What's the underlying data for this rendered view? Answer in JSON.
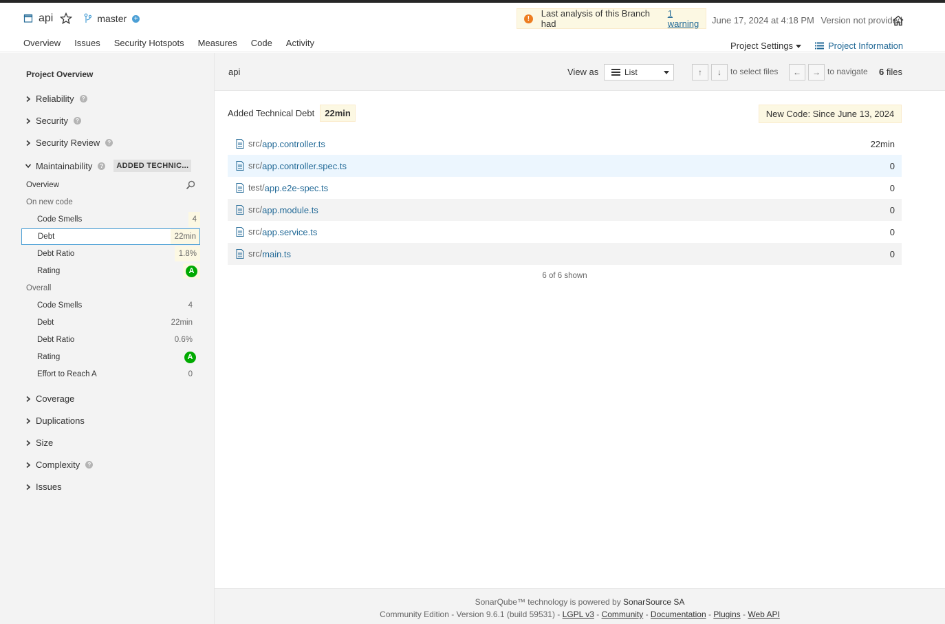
{
  "header": {
    "project_name": "api",
    "branch": "master",
    "warning_text": "Last analysis of this Branch had",
    "warning_link": "1 warning",
    "analysis_date": "June 17, 2024 at 4:18 PM",
    "version": "Version not provided",
    "tabs": [
      {
        "label": "Overview"
      },
      {
        "label": "Issues"
      },
      {
        "label": "Security Hotspots"
      },
      {
        "label": "Measures"
      },
      {
        "label": "Code"
      },
      {
        "label": "Activity"
      }
    ],
    "project_settings": "Project Settings",
    "project_information": "Project Information"
  },
  "sidebar": {
    "title": "Project Overview",
    "domains": {
      "reliability": "Reliability",
      "security": "Security",
      "security_review": "Security Review",
      "maintainability": "Maintainability",
      "maintainability_tag": "ADDED TECHNIC...",
      "coverage": "Coverage",
      "duplications": "Duplications",
      "size": "Size",
      "complexity": "Complexity",
      "issues": "Issues"
    },
    "overview_label": "Overview",
    "on_new_code_label": "On new code",
    "overall_label": "Overall",
    "new_code": {
      "code_smells": {
        "label": "Code Smells",
        "value": "4"
      },
      "debt": {
        "label": "Debt",
        "value": "22min"
      },
      "debt_ratio": {
        "label": "Debt Ratio",
        "value": "1.8%"
      },
      "rating": {
        "label": "Rating",
        "value": "A"
      }
    },
    "overall": {
      "code_smells": {
        "label": "Code Smells",
        "value": "4"
      },
      "debt": {
        "label": "Debt",
        "value": "22min"
      },
      "debt_ratio": {
        "label": "Debt Ratio",
        "value": "0.6%"
      },
      "rating": {
        "label": "Rating",
        "value": "A"
      },
      "effort": {
        "label": "Effort to Reach A",
        "value": "0"
      }
    }
  },
  "main": {
    "breadcrumb": "api",
    "view_as_label": "View as",
    "view_as_value": "List",
    "select_hint": "to select files",
    "navigate_hint": "to navigate",
    "files_count": "6",
    "files_label": "files",
    "metric_label": "Added Technical Debt",
    "metric_value": "22min",
    "new_code_label": "New Code: Since June 13, 2024",
    "files": [
      {
        "path": "src/",
        "name": "app.controller.ts",
        "value": "22min"
      },
      {
        "path": "src/",
        "name": "app.controller.spec.ts",
        "value": "0"
      },
      {
        "path": "test/",
        "name": "app.e2e-spec.ts",
        "value": "0"
      },
      {
        "path": "src/",
        "name": "app.module.ts",
        "value": "0"
      },
      {
        "path": "src/",
        "name": "app.service.ts",
        "value": "0"
      },
      {
        "path": "src/",
        "name": "main.ts",
        "value": "0"
      }
    ],
    "shown_text": "6 of 6 shown"
  },
  "footer": {
    "line1_prefix": "SonarQube™ technology is powered by",
    "line1_brand": "SonarSource SA",
    "line2_prefix": "Community Edition - Version 9.6.1 (build 59531) -",
    "links": {
      "lgpl": "LGPL v3",
      "community": "Community",
      "documentation": "Documentation",
      "plugins": "Plugins",
      "webapi": "Web API"
    }
  },
  "colors": {
    "accent": "#4b9fd5",
    "link": "#236a97",
    "rating_a": "#00aa00",
    "highlight": "#fcf8e3",
    "warning": "#ed7d20"
  }
}
